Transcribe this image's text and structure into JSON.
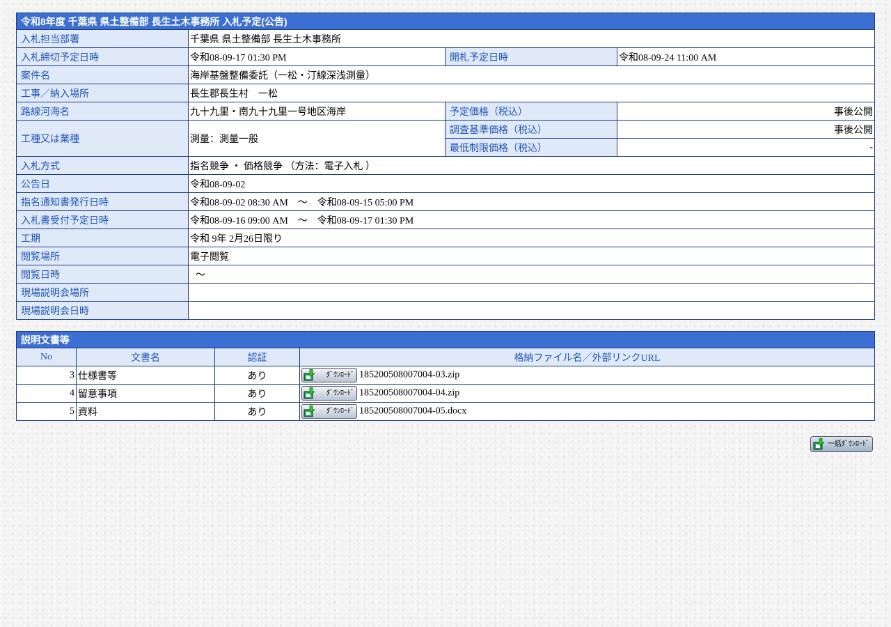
{
  "title": "令和8年度 千葉県 県土整備部 長生土木事務所 入札予定(公告)",
  "rows": {
    "dept_label": "入札担当部署",
    "dept_value": "千葉県 県土整備部 長生土木事務所",
    "deadline_label": "入札締切予定日時",
    "deadline_value": "令和08-09-17 01:30 PM",
    "opening_label": "開札予定日時",
    "opening_value": "令和08-09-24 11:00 AM",
    "case_label": "案件名",
    "case_value": "海岸基盤整備委託（一松・汀線深浅測量）",
    "place_label": "工事／納入場所",
    "place_value": "長生郡長生村　一松",
    "route_label": "路線河海名",
    "route_value": "九十九里・南九十九里一号地区海岸",
    "price_label": "予定価格（税込）",
    "price_value": "事後公開",
    "kind_label": "工種又は業種",
    "kind_value": "測量：測量一般",
    "survey_label": "調査基準価格（税込）",
    "survey_value": "事後公開",
    "min_label": "最低制限価格（税込）",
    "min_value": "-",
    "method_label": "入札方式",
    "method_value": "指名競争 ・ 価格競争 （方法：電子入札 ）",
    "notice_label": "公告日",
    "notice_value": "令和08-09-02",
    "nominate_label": "指名通知書発行日時",
    "nominate_value": "令和08-09-02 08:30 AM　～　令和08-09-15 05:00 PM",
    "receipt_label": "入札書受付予定日時",
    "receipt_value": "令和08-09-16 09:00 AM　～　令和08-09-17 01:30 PM",
    "period_label": "工期",
    "period_value": "令和 9年 2月26日限り",
    "view_place_label": "閲覧場所",
    "view_place_value": "電子閲覧",
    "view_time_label": "閲覧日時",
    "view_time_value": "～",
    "site_place_label": "現場説明会場所",
    "site_place_value": "",
    "site_time_label": "現場説明会日時",
    "site_time_value": ""
  },
  "docs": {
    "title": "説明文書等",
    "col_no": "No",
    "col_name": "文書名",
    "col_auth": "認証",
    "col_file": "格納ファイル名／外部リンクURL",
    "download_label": "ﾀﾞｳﾝﾛｰﾄﾞ",
    "items": [
      {
        "no": "3",
        "name": "仕様書等",
        "auth": "あり",
        "file": "185200508007004-03.zip"
      },
      {
        "no": "4",
        "name": "留意事項",
        "auth": "あり",
        "file": "185200508007004-04.zip"
      },
      {
        "no": "5",
        "name": "資料",
        "auth": "あり",
        "file": "185200508007004-05.docx"
      }
    ]
  },
  "bulk_download_label": "一括ﾀﾞｳﾝﾛｰﾄﾞ"
}
